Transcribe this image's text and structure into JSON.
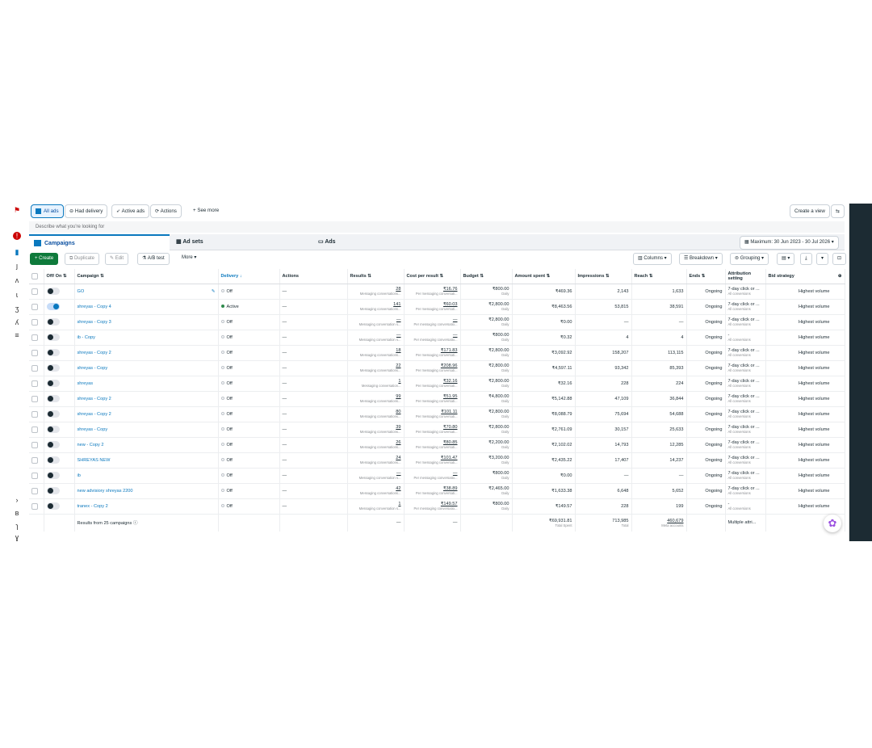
{
  "filters": {
    "all_ads": "All ads",
    "had_delivery": "Had delivery",
    "active_ads": "Active ads",
    "actions": "Actions",
    "see_more": "+ See more",
    "create_view": "Create a view"
  },
  "search": {
    "placeholder": "Describe what you're looking for"
  },
  "levels": {
    "campaigns": "Campaigns",
    "ad_sets": "Ad sets",
    "ads": "Ads",
    "date_range": "Maximum: 30 Jun 2023 - 30 Jul 2026"
  },
  "toolbar": {
    "create": "+ Create",
    "duplicate": "Duplicate",
    "edit": "Edit",
    "ab_test": "A/B test",
    "more": "More ▾",
    "columns": "Columns ▾",
    "breakdown": "Breakdown ▾",
    "grouping": "Grouping ▾"
  },
  "columns": {
    "offon": "Off/ On",
    "campaign": "Campaign",
    "delivery": "Delivery ↓",
    "actions": "Actions",
    "results": "Results",
    "cpr": "Cost per result",
    "budget": "Budget",
    "spent": "Amount spent",
    "impressions": "Impressions",
    "reach": "Reach",
    "ends": "Ends",
    "attribution": "Attribution setting",
    "bid": "Bid strategy"
  },
  "rows": [
    {
      "name": "GO",
      "on": false,
      "delivery": "Off",
      "actions": "—",
      "results": "28",
      "results_sub": "Messaging conversations...",
      "cpr": "₹16.76",
      "cpr_sub": "Per messaging conversati...",
      "budget": "₹800.00",
      "budget_sub": "Daily",
      "spent": "₹469.36",
      "impressions": "2,143",
      "reach": "1,633",
      "ends": "Ongoing",
      "attr": "7-day click or ...",
      "attr_sub": "All conversions",
      "bid": "Highest volume"
    },
    {
      "name": "shreyas - Copy 4",
      "on": true,
      "delivery": "Active",
      "actions": "—",
      "results": "141",
      "results_sub": "Messaging conversations...",
      "cpr": "₹60.03",
      "cpr_sub": "Per messaging conversati...",
      "budget": "₹2,800.00",
      "budget_sub": "Daily",
      "spent": "₹8,463.56",
      "impressions": "53,815",
      "reach": "38,591",
      "ends": "Ongoing",
      "attr": "7-day click or ...",
      "attr_sub": "All conversions",
      "bid": "Highest volume"
    },
    {
      "name": "shreyas - Copy 3",
      "on": false,
      "delivery": "Off",
      "actions": "—",
      "results": "—",
      "results_sub": "Messaging conversation s...",
      "cpr": "—",
      "cpr_sub": "Per messaging conversatio...",
      "budget": "₹2,800.00",
      "budget_sub": "Daily",
      "spent": "₹0.00",
      "impressions": "—",
      "reach": "—",
      "ends": "Ongoing",
      "attr": "7-day click or ...",
      "attr_sub": "All conversions",
      "bid": "Highest volume"
    },
    {
      "name": "ib - Copy",
      "on": false,
      "delivery": "Off",
      "actions": "—",
      "results": "—",
      "results_sub": "Messaging conversation s...",
      "cpr": "—",
      "cpr_sub": "Per messaging conversatio...",
      "budget": "₹800.00",
      "budget_sub": "Daily",
      "spent": "₹0.32",
      "impressions": "4",
      "reach": "4",
      "ends": "Ongoing",
      "attr": "-",
      "attr_sub": "All conversions",
      "bid": "Highest volume"
    },
    {
      "name": "shreyas - Copy 2",
      "on": false,
      "delivery": "Off",
      "actions": "—",
      "results": "18",
      "results_sub": "Messaging conversations...",
      "cpr": "₹171.83",
      "cpr_sub": "Per messaging conversati...",
      "budget": "₹2,800.00",
      "budget_sub": "Daily",
      "spent": "₹3,092.92",
      "impressions": "158,207",
      "reach": "113,115",
      "ends": "Ongoing",
      "attr": "7-day click or ...",
      "attr_sub": "All conversions",
      "bid": "Highest volume"
    },
    {
      "name": "shreyas - Copy",
      "on": false,
      "delivery": "Off",
      "actions": "—",
      "results": "22",
      "results_sub": "Messaging conversations...",
      "cpr": "₹208.96",
      "cpr_sub": "Per messaging conversati...",
      "budget": "₹2,800.00",
      "budget_sub": "Daily",
      "spent": "₹4,597.11",
      "impressions": "93,342",
      "reach": "85,393",
      "ends": "Ongoing",
      "attr": "7-day click or ...",
      "attr_sub": "All conversions",
      "bid": "Highest volume"
    },
    {
      "name": "shreyas",
      "on": false,
      "delivery": "Off",
      "actions": "—",
      "results": "1",
      "results_sub": "Messaging conversation...",
      "cpr": "₹32.16",
      "cpr_sub": "Per messaging conversati...",
      "budget": "₹2,800.00",
      "budget_sub": "Daily",
      "spent": "₹32.16",
      "impressions": "228",
      "reach": "224",
      "ends": "Ongoing",
      "attr": "7-day click or ...",
      "attr_sub": "All conversions",
      "bid": "Highest volume"
    },
    {
      "name": "shreyas - Copy 2",
      "on": false,
      "delivery": "Off",
      "actions": "—",
      "results": "99",
      "results_sub": "Messaging conversations...",
      "cpr": "₹51.95",
      "cpr_sub": "Per messaging conversati...",
      "budget": "₹4,800.00",
      "budget_sub": "Daily",
      "spent": "₹5,142.88",
      "impressions": "47,109",
      "reach": "36,844",
      "ends": "Ongoing",
      "attr": "7-day click or ...",
      "attr_sub": "All conversions",
      "bid": "Highest volume"
    },
    {
      "name": "shreyas - Copy 2",
      "on": false,
      "delivery": "Off",
      "actions": "—",
      "results": "80",
      "results_sub": "Messaging conversations...",
      "cpr": "₹101.11",
      "cpr_sub": "Per messaging conversati...",
      "budget": "₹2,800.00",
      "budget_sub": "Daily",
      "spent": "₹8,088.79",
      "impressions": "75,694",
      "reach": "54,688",
      "ends": "Ongoing",
      "attr": "7-day click or ...",
      "attr_sub": "All conversions",
      "bid": "Highest volume"
    },
    {
      "name": "shreyas - Copy",
      "on": false,
      "delivery": "Off",
      "actions": "—",
      "results": "39",
      "results_sub": "Messaging conversations...",
      "cpr": "₹70.80",
      "cpr_sub": "Per messaging conversati...",
      "budget": "₹2,800.00",
      "budget_sub": "Daily",
      "spent": "₹2,761.09",
      "impressions": "30,157",
      "reach": "25,633",
      "ends": "Ongoing",
      "attr": "7-day click or ...",
      "attr_sub": "All conversions",
      "bid": "Highest volume"
    },
    {
      "name": "new - Copy 2",
      "on": false,
      "delivery": "Off",
      "actions": "—",
      "results": "26",
      "results_sub": "Messaging conversations...",
      "cpr": "₹80.85",
      "cpr_sub": "Per messaging conversati...",
      "budget": "₹2,200.00",
      "budget_sub": "Daily",
      "spent": "₹2,102.02",
      "impressions": "14,793",
      "reach": "12,285",
      "ends": "Ongoing",
      "attr": "7-day click or ...",
      "attr_sub": "All conversions",
      "bid": "Highest volume"
    },
    {
      "name": "SHREYAS NEW",
      "on": false,
      "delivery": "Off",
      "actions": "—",
      "results": "24",
      "results_sub": "Messaging conversations...",
      "cpr": "₹101.47",
      "cpr_sub": "Per messaging conversati...",
      "budget": "₹3,200.00",
      "budget_sub": "Daily",
      "spent": "₹2,435.22",
      "impressions": "17,407",
      "reach": "14,237",
      "ends": "Ongoing",
      "attr": "7-day click or ...",
      "attr_sub": "All conversions",
      "bid": "Highest volume"
    },
    {
      "name": "ib",
      "on": false,
      "delivery": "Off",
      "actions": "—",
      "results": "—",
      "results_sub": "Messaging conversation s...",
      "cpr": "—",
      "cpr_sub": "Per messaging conversatio...",
      "budget": "₹800.00",
      "budget_sub": "Daily",
      "spent": "₹0.00",
      "impressions": "—",
      "reach": "—",
      "ends": "Ongoing",
      "attr": "7-day click or ...",
      "attr_sub": "All conversions",
      "bid": "Highest volume"
    },
    {
      "name": "new advisiory shreyas 2200",
      "on": false,
      "delivery": "Off",
      "actions": "—",
      "results": "42",
      "results_sub": "Messaging conversations...",
      "cpr": "₹38.89",
      "cpr_sub": "Per messaging conversati...",
      "budget": "₹2,465.00",
      "budget_sub": "Daily",
      "spent": "₹1,633.38",
      "impressions": "6,648",
      "reach": "5,652",
      "ends": "Ongoing",
      "attr": "7-day click or ...",
      "attr_sub": "All conversions",
      "bid": "Highest volume"
    },
    {
      "name": "tranex - Copy 2",
      "on": false,
      "delivery": "Off",
      "actions": "—",
      "results": "1",
      "results_sub": "Messaging conversation s...",
      "cpr": "₹149.57",
      "cpr_sub": "Per messaging conversatio...",
      "budget": "₹800.00",
      "budget_sub": "Daily",
      "spent": "₹149.57",
      "impressions": "228",
      "reach": "199",
      "ends": "Ongoing",
      "attr": "-",
      "attr_sub": "All conversions",
      "bid": "Highest volume"
    }
  ],
  "footer": {
    "label": "Results from 25 campaigns",
    "results": "—",
    "cpr": "—",
    "spent": "₹69,931.81",
    "spent_sub": "Total Spent",
    "impressions": "713,985",
    "impressions_sub": "Total",
    "reach": "460,679",
    "reach_sub": "Meta accounts",
    "attr": "Multiple attri..."
  },
  "colors": {
    "accent": "#0a78be",
    "create": "#0e7a3b",
    "right_bar": "#1c2b33"
  }
}
